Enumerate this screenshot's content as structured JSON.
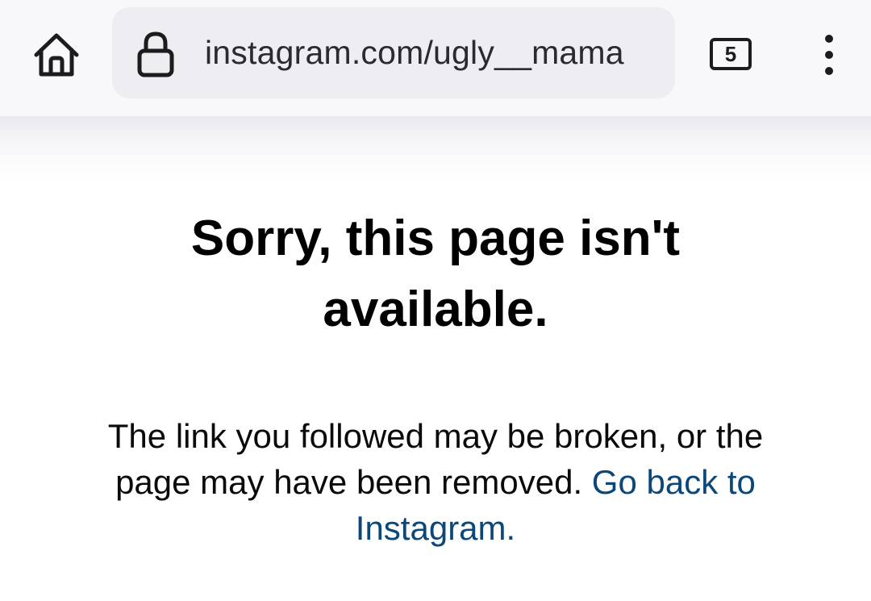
{
  "browser": {
    "url": "instagram.com/ugly__mama",
    "tab_count": "5",
    "icons": {
      "home": "home-icon",
      "lock": "lock-icon",
      "tabs": "tab-switcher-icon",
      "menu": "more-vertical-icon"
    }
  },
  "page": {
    "heading": "Sorry, this page isn't available.",
    "message": "The link you followed may be broken, or the page may have been removed.",
    "link_text": "Go back to Instagram.",
    "colors": {
      "link": "#0b4779",
      "text": "#000000"
    }
  }
}
